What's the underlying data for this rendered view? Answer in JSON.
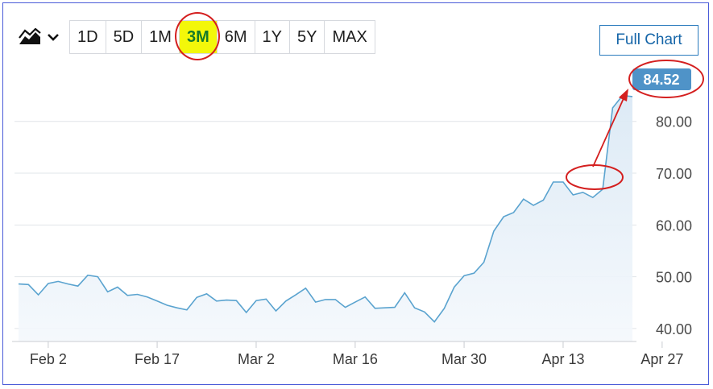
{
  "toolbar": {
    "chart_type_icon": "area-chart-icon",
    "dropdown_icon": "chevron-down-icon",
    "ranges": [
      "1D",
      "5D",
      "1M",
      "3M",
      "6M",
      "1Y",
      "5Y",
      "MAX"
    ],
    "active_range": "3M",
    "full_chart_label": "Full Chart"
  },
  "colors": {
    "line": "#5aa3cf",
    "area_top": "#dbe9f5",
    "last_badge": "#4f93c8",
    "annotation": "#d41f1f",
    "highlight": "#f3f70a",
    "grid": "#e1e4e8"
  },
  "chart_data": {
    "type": "area",
    "ylim": [
      37.5,
      91
    ],
    "y_ticks": [
      "40.00",
      "50.00",
      "60.00",
      "70.00",
      "80.00"
    ],
    "y_tick_values": [
      40,
      50,
      60,
      70,
      80
    ],
    "x_tick_labels": [
      "Feb 2",
      "Feb 17",
      "Mar 2",
      "Mar 16",
      "Mar 30",
      "Apr 13",
      "Apr 27"
    ],
    "x_tick_index": [
      3,
      14,
      24,
      34,
      45,
      55,
      65
    ],
    "last_value_label": "84.52",
    "values": [
      48.6,
      48.5,
      46.5,
      48.7,
      49.1,
      48.6,
      48.2,
      50.3,
      50.0,
      47.1,
      48.0,
      46.4,
      46.6,
      46.1,
      45.3,
      44.5,
      44.0,
      43.6,
      46.0,
      46.7,
      45.3,
      45.5,
      45.4,
      43.1,
      45.4,
      45.7,
      43.4,
      45.3,
      46.5,
      47.8,
      45.1,
      45.6,
      45.6,
      44.1,
      45.1,
      46.1,
      43.9,
      44.0,
      44.1,
      46.9,
      44.0,
      43.2,
      41.3,
      43.9,
      48.0,
      50.2,
      50.7,
      52.8,
      58.8,
      61.6,
      62.4,
      65.0,
      63.8,
      64.8,
      68.3,
      68.3,
      65.8,
      66.3,
      65.3,
      66.9,
      82.6,
      85.0,
      84.8
    ]
  }
}
